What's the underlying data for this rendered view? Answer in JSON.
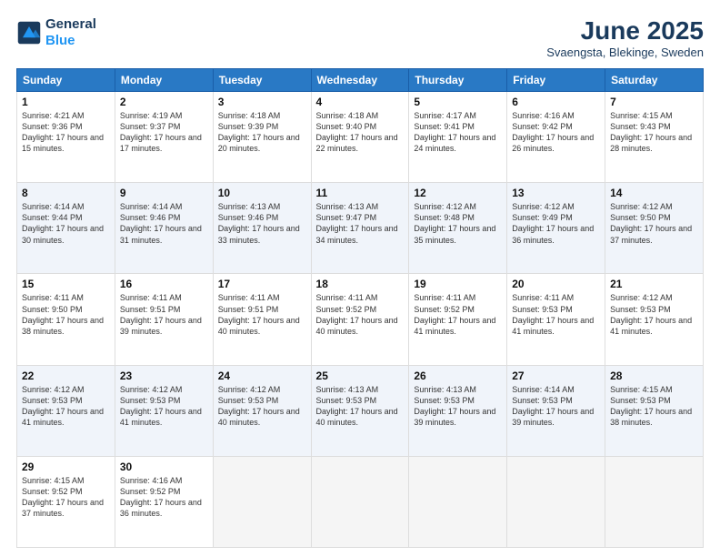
{
  "header": {
    "logo_line1": "General",
    "logo_line2": "Blue",
    "month_title": "June 2025",
    "location": "Svaengsta, Blekinge, Sweden"
  },
  "days_of_week": [
    "Sunday",
    "Monday",
    "Tuesday",
    "Wednesday",
    "Thursday",
    "Friday",
    "Saturday"
  ],
  "weeks": [
    [
      {
        "day": "1",
        "sunrise": "4:21 AM",
        "sunset": "9:36 PM",
        "daylight": "17 hours and 15 minutes."
      },
      {
        "day": "2",
        "sunrise": "4:19 AM",
        "sunset": "9:37 PM",
        "daylight": "17 hours and 17 minutes."
      },
      {
        "day": "3",
        "sunrise": "4:18 AM",
        "sunset": "9:39 PM",
        "daylight": "17 hours and 20 minutes."
      },
      {
        "day": "4",
        "sunrise": "4:18 AM",
        "sunset": "9:40 PM",
        "daylight": "17 hours and 22 minutes."
      },
      {
        "day": "5",
        "sunrise": "4:17 AM",
        "sunset": "9:41 PM",
        "daylight": "17 hours and 24 minutes."
      },
      {
        "day": "6",
        "sunrise": "4:16 AM",
        "sunset": "9:42 PM",
        "daylight": "17 hours and 26 minutes."
      },
      {
        "day": "7",
        "sunrise": "4:15 AM",
        "sunset": "9:43 PM",
        "daylight": "17 hours and 28 minutes."
      }
    ],
    [
      {
        "day": "8",
        "sunrise": "4:14 AM",
        "sunset": "9:44 PM",
        "daylight": "17 hours and 30 minutes."
      },
      {
        "day": "9",
        "sunrise": "4:14 AM",
        "sunset": "9:46 PM",
        "daylight": "17 hours and 31 minutes."
      },
      {
        "day": "10",
        "sunrise": "4:13 AM",
        "sunset": "9:46 PM",
        "daylight": "17 hours and 33 minutes."
      },
      {
        "day": "11",
        "sunrise": "4:13 AM",
        "sunset": "9:47 PM",
        "daylight": "17 hours and 34 minutes."
      },
      {
        "day": "12",
        "sunrise": "4:12 AM",
        "sunset": "9:48 PM",
        "daylight": "17 hours and 35 minutes."
      },
      {
        "day": "13",
        "sunrise": "4:12 AM",
        "sunset": "9:49 PM",
        "daylight": "17 hours and 36 minutes."
      },
      {
        "day": "14",
        "sunrise": "4:12 AM",
        "sunset": "9:50 PM",
        "daylight": "17 hours and 37 minutes."
      }
    ],
    [
      {
        "day": "15",
        "sunrise": "4:11 AM",
        "sunset": "9:50 PM",
        "daylight": "17 hours and 38 minutes."
      },
      {
        "day": "16",
        "sunrise": "4:11 AM",
        "sunset": "9:51 PM",
        "daylight": "17 hours and 39 minutes."
      },
      {
        "day": "17",
        "sunrise": "4:11 AM",
        "sunset": "9:51 PM",
        "daylight": "17 hours and 40 minutes."
      },
      {
        "day": "18",
        "sunrise": "4:11 AM",
        "sunset": "9:52 PM",
        "daylight": "17 hours and 40 minutes."
      },
      {
        "day": "19",
        "sunrise": "4:11 AM",
        "sunset": "9:52 PM",
        "daylight": "17 hours and 41 minutes."
      },
      {
        "day": "20",
        "sunrise": "4:11 AM",
        "sunset": "9:53 PM",
        "daylight": "17 hours and 41 minutes."
      },
      {
        "day": "21",
        "sunrise": "4:12 AM",
        "sunset": "9:53 PM",
        "daylight": "17 hours and 41 minutes."
      }
    ],
    [
      {
        "day": "22",
        "sunrise": "4:12 AM",
        "sunset": "9:53 PM",
        "daylight": "17 hours and 41 minutes."
      },
      {
        "day": "23",
        "sunrise": "4:12 AM",
        "sunset": "9:53 PM",
        "daylight": "17 hours and 41 minutes."
      },
      {
        "day": "24",
        "sunrise": "4:12 AM",
        "sunset": "9:53 PM",
        "daylight": "17 hours and 40 minutes."
      },
      {
        "day": "25",
        "sunrise": "4:13 AM",
        "sunset": "9:53 PM",
        "daylight": "17 hours and 40 minutes."
      },
      {
        "day": "26",
        "sunrise": "4:13 AM",
        "sunset": "9:53 PM",
        "daylight": "17 hours and 39 minutes."
      },
      {
        "day": "27",
        "sunrise": "4:14 AM",
        "sunset": "9:53 PM",
        "daylight": "17 hours and 39 minutes."
      },
      {
        "day": "28",
        "sunrise": "4:15 AM",
        "sunset": "9:53 PM",
        "daylight": "17 hours and 38 minutes."
      }
    ],
    [
      {
        "day": "29",
        "sunrise": "4:15 AM",
        "sunset": "9:52 PM",
        "daylight": "17 hours and 37 minutes."
      },
      {
        "day": "30",
        "sunrise": "4:16 AM",
        "sunset": "9:52 PM",
        "daylight": "17 hours and 36 minutes."
      },
      null,
      null,
      null,
      null,
      null
    ]
  ]
}
